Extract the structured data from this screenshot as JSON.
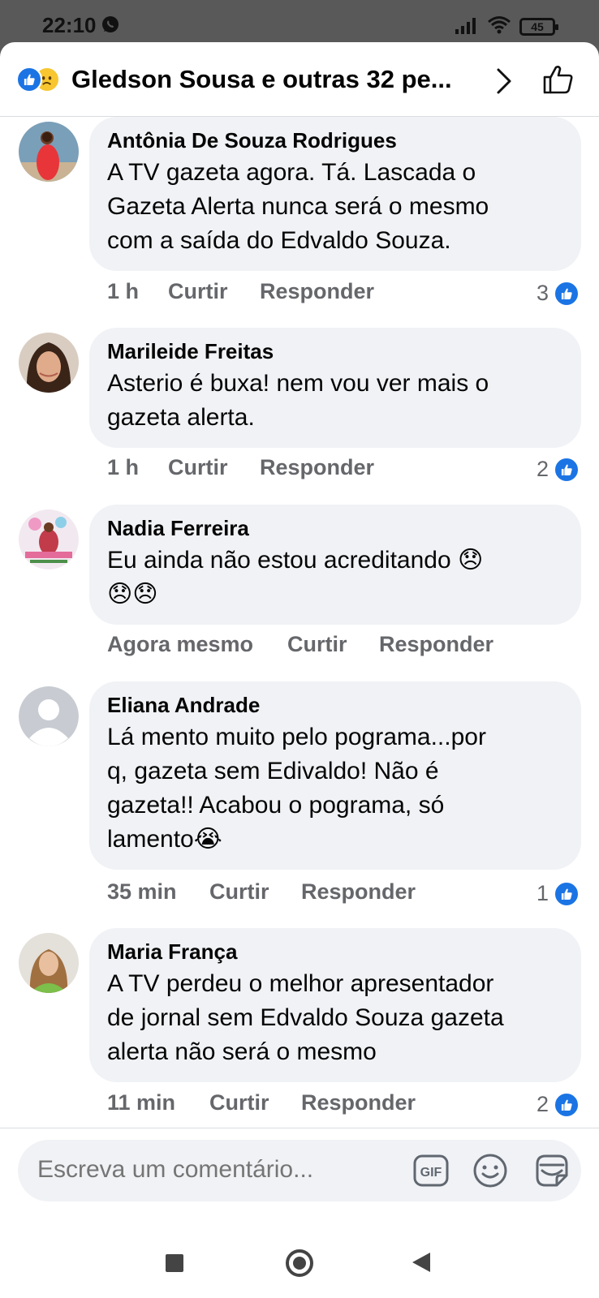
{
  "status_bar": {
    "time": "22:10",
    "battery": "45"
  },
  "header": {
    "title": "Gledson Sousa e outras 32 pe..."
  },
  "colors": {
    "accent": "#1b74e4",
    "bubble": "#f0f2f5",
    "meta_text": "#65676b",
    "sad_reaction": "#f7c631"
  },
  "comments": [
    {
      "author": "Antônia De Souza Rodrigues",
      "lines": [
        "A TV gazeta agora.  Tá. Lascada  o",
        "Gazeta Alerta  nunca será o mesmo",
        "com a saída do Edvaldo Souza."
      ],
      "time": "1 h",
      "like_label": "Curtir",
      "reply_label": "Responder",
      "reactions": "3"
    },
    {
      "author": "Marileide Freitas",
      "lines": [
        "Asterio é buxa! nem vou ver mais o",
        "gazeta alerta."
      ],
      "time": "1 h",
      "like_label": "Curtir",
      "reply_label": "Responder",
      "reactions": "2"
    },
    {
      "author": "Nadia Ferreira",
      "lines": [
        "Eu ainda não estou acreditando 😞",
        "😞😞"
      ],
      "time": "Agora mesmo",
      "like_label": "Curtir",
      "reply_label": "Responder",
      "reactions": ""
    },
    {
      "author": "Eliana Andrade",
      "lines": [
        "Lá mento muito pelo pograma...por",
        "q, gazeta sem Edivaldo! Não é",
        "gazeta!! Acabou o pograma, só",
        "lamento😭"
      ],
      "time": "35 min",
      "like_label": "Curtir",
      "reply_label": "Responder",
      "reactions": "1"
    },
    {
      "author": "Maria França",
      "lines": [
        "A TV perdeu o melhor apresentador",
        "de jornal sem Edvaldo Souza gazeta",
        "alerta não será o mesmo"
      ],
      "time": "11 min",
      "like_label": "Curtir",
      "reply_label": "Responder",
      "reactions": "2"
    }
  ],
  "composer": {
    "placeholder": "Escreva um comentário..."
  },
  "icons": [
    "whatsapp-icon",
    "signal-icon",
    "wifi-icon",
    "like-reaction-icon",
    "sad-reaction-icon",
    "chevron-right-icon",
    "like-outline-icon",
    "gif-icon",
    "smiley-icon",
    "sticker-icon",
    "nav-recents-icon",
    "nav-home-icon",
    "nav-back-icon"
  ]
}
